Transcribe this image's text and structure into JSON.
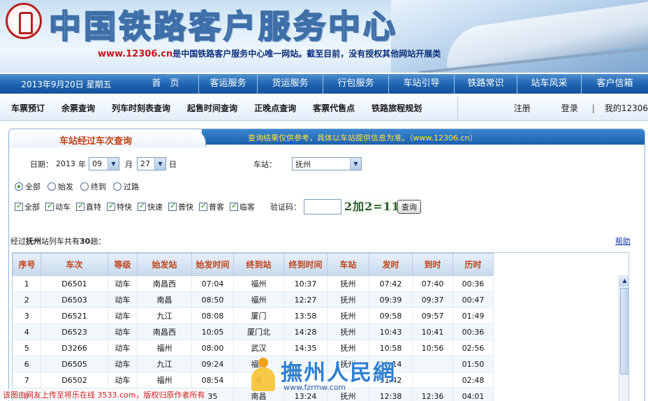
{
  "banner": {
    "title": "中国铁路客户服务中心",
    "slogan_domain": "www.12306.cn",
    "slogan_text": "是中国铁路客户服务中心唯一网站。截至目前，没有授权其他网站开展类"
  },
  "mainnav": {
    "date": "2013年9月20日 星期五",
    "items": [
      "首　页",
      "客运服务",
      "货运服务",
      "行包服务",
      "车站引导",
      "铁路常识",
      "站车风采",
      "客户信箱"
    ]
  },
  "subnav": {
    "items": [
      "车票预订",
      "余票查询",
      "列车时刻表查询",
      "起售时间查询",
      "正晚点查询",
      "客票代售点",
      "铁路旅程规划"
    ],
    "register": "注册",
    "login": "登录",
    "separator": "|",
    "my_account": "我的12306"
  },
  "panel": {
    "title": "车站经过车次查询",
    "note": "查询结果仅供参考，具体以车站提供信息为准。（www.12306.cn）",
    "date_label": "日期：",
    "year": "2013",
    "year_unit": "年",
    "month": "09",
    "month_unit": "月",
    "day": "27",
    "day_unit": "日",
    "station_label": "车站：",
    "station": "抚州",
    "radios": [
      {
        "label": "全部",
        "checked": true
      },
      {
        "label": "始发",
        "checked": false
      },
      {
        "label": "终到",
        "checked": false
      },
      {
        "label": "过路",
        "checked": false
      }
    ],
    "checks": [
      {
        "label": "全部",
        "checked": true
      },
      {
        "label": "动车",
        "checked": true
      },
      {
        "label": "直特",
        "checked": true
      },
      {
        "label": "特快",
        "checked": true
      },
      {
        "label": "快速",
        "checked": true
      },
      {
        "label": "普快",
        "checked": true
      },
      {
        "label": "普客",
        "checked": true
      },
      {
        "label": "临客",
        "checked": true
      }
    ],
    "captcha_label": "验证码：",
    "captcha_value": "",
    "captcha_image_text": "2加2=11",
    "query_button": "查询",
    "summary_prefix": "经过",
    "summary_station": "抚州",
    "summary_middle": "站列车共有",
    "summary_count": "30",
    "summary_suffix": "趟：",
    "help_link": "帮助"
  },
  "table": {
    "headers": [
      "序号",
      "车次",
      "等级",
      "始发站",
      "始发时间",
      "终到站",
      "终到时间",
      "车站",
      "发时",
      "到时",
      "历时"
    ],
    "rows": [
      [
        "1",
        "D6501",
        "动车",
        "南昌西",
        "07:04",
        "福州",
        "10:37",
        "抚州",
        "07:42",
        "07:40",
        "00:36"
      ],
      [
        "2",
        "D6503",
        "动车",
        "南昌",
        "08:50",
        "福州",
        "12:27",
        "抚州",
        "09:39",
        "09:37",
        "00:47"
      ],
      [
        "3",
        "D6521",
        "动车",
        "九江",
        "08:08",
        "厦门",
        "13:58",
        "抚州",
        "09:58",
        "09:57",
        "01:49"
      ],
      [
        "4",
        "D6523",
        "动车",
        "南昌西",
        "10:05",
        "厦门北",
        "14:28",
        "抚州",
        "10:43",
        "10:41",
        "00:36"
      ],
      [
        "5",
        "D3266",
        "动车",
        "福州",
        "08:00",
        "武汉",
        "14:35",
        "抚州",
        "10:58",
        "10:56",
        "02:56"
      ],
      [
        "6",
        "D6505",
        "动车",
        "九江",
        "09:24",
        "福州",
        "",
        "抚州",
        "11:14",
        "",
        "01:50"
      ],
      [
        "7",
        "D6502",
        "动车",
        "福州",
        "08:54",
        "南",
        "",
        "",
        "11:42",
        "",
        "02:48"
      ],
      [
        "8",
        "",
        "",
        "",
        "35",
        "南昌",
        "13:24",
        "抚州",
        "12:38",
        "12:36",
        "04:01"
      ]
    ]
  },
  "watermark": {
    "title": "撫州人民網",
    "url": "www.fzrmw.com"
  },
  "footer_note": "该图由网友上传至将乐在线 3533.com，版权归原作者所有"
}
